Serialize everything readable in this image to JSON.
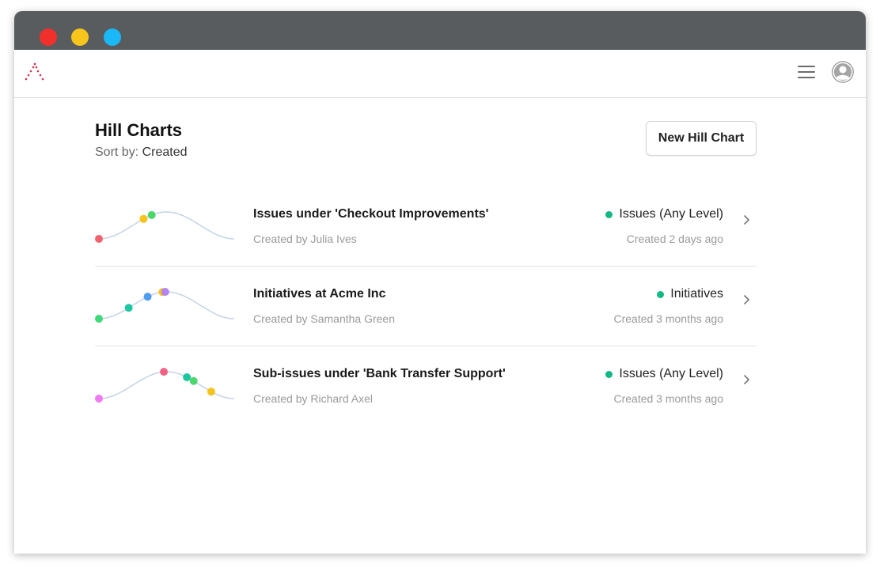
{
  "window": {
    "controls": [
      {
        "name": "close",
        "color": "#f2302b"
      },
      {
        "name": "minimize",
        "color": "#f8c51c"
      },
      {
        "name": "zoom",
        "color": "#1ab8f7"
      }
    ]
  },
  "appbar": {
    "logo_color": "#d7324f",
    "menu_icon": "hamburger-menu-icon",
    "avatar_icon": "user-avatar-icon"
  },
  "page": {
    "title": "Hill Charts",
    "sort_label": "Sort by:",
    "sort_value": "Created",
    "new_button_label": "New Hill Chart"
  },
  "charts": [
    {
      "title": "Issues under 'Checkout Improvements'",
      "creator": "Created by Julia Ives",
      "type_label": "Issues (Any Level)",
      "type_color": "#12b886",
      "created": "Created 2 days ago",
      "dots": [
        {
          "progress": 0.0,
          "color": "#f06270"
        },
        {
          "progress": 0.33,
          "color": "#f6c21c"
        },
        {
          "progress": 0.39,
          "color": "#4cd76c"
        }
      ]
    },
    {
      "title": "Initiatives at Acme Inc",
      "creator": "Created by Samantha Green",
      "type_label": "Initiatives",
      "type_color": "#12b886",
      "created": "Created 3 months ago",
      "dots": [
        {
          "progress": 0.0,
          "color": "#3fd97a"
        },
        {
          "progress": 0.22,
          "color": "#1fc7a0"
        },
        {
          "progress": 0.36,
          "color": "#4f9cf0"
        },
        {
          "progress": 0.47,
          "color": "#f6c21c"
        },
        {
          "progress": 0.49,
          "color": "#b084f2"
        }
      ]
    },
    {
      "title": "Sub-issues under 'Bank Transfer Support'",
      "creator": "Created by Richard Axel",
      "type_label": "Issues (Any Level)",
      "type_color": "#12b886",
      "created": "Created 3 months ago",
      "dots": [
        {
          "progress": 0.0,
          "color": "#ee7cf0"
        },
        {
          "progress": 0.48,
          "color": "#f06283"
        },
        {
          "progress": 0.65,
          "color": "#1fc7a0"
        },
        {
          "progress": 0.7,
          "color": "#4cd76c"
        },
        {
          "progress": 0.83,
          "color": "#f6c21c"
        }
      ]
    }
  ],
  "colors": {
    "curve": "#c3d3e6",
    "chevron": "#777777"
  }
}
